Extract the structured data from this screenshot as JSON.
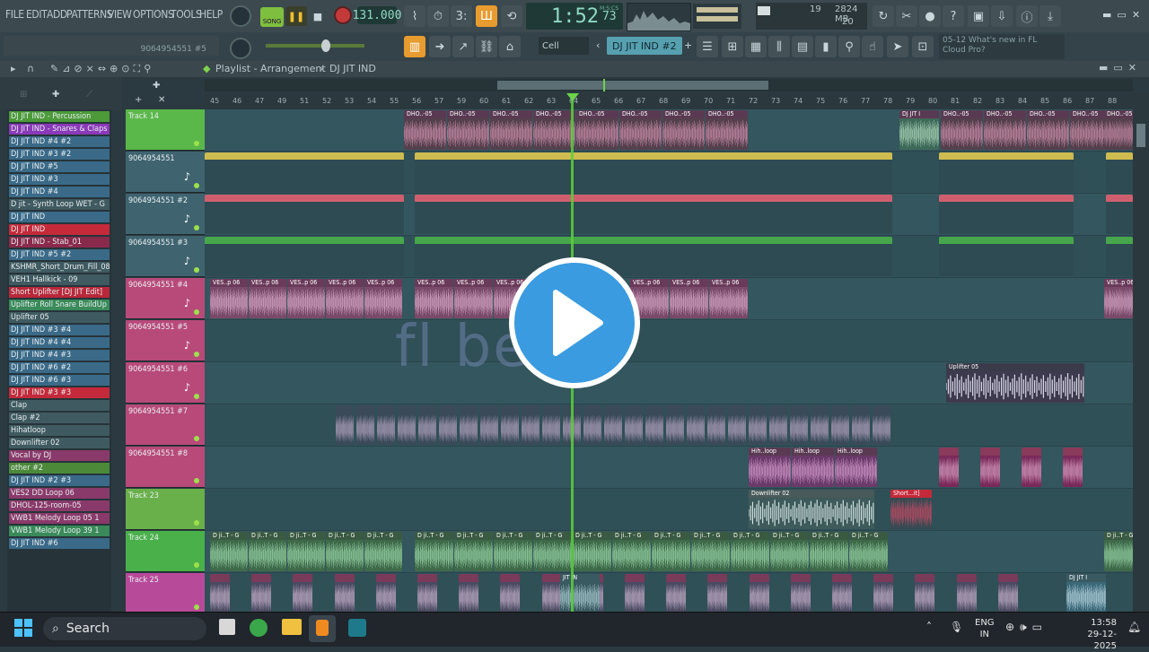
{
  "menu": [
    "FILE",
    "EDIT",
    "ADD",
    "PATTERNS",
    "VIEW",
    "OPTIONS",
    "TOOLS",
    "HELP"
  ],
  "transport": {
    "song_label": "SONG",
    "tempo": "131.000",
    "time": "1:52",
    "time_small": "73",
    "time_unit": "M:S:CS"
  },
  "cpu": {
    "voices": "19",
    "memory": "2824 MB",
    "polyphony": "20"
  },
  "hint": "9064954551 #5",
  "snap": "Cell",
  "pattern": "DJ JIT IND #2",
  "news": {
    "date": "05-12",
    "text": "What's new in FL Cloud Pro?"
  },
  "playlist": {
    "title": "Playlist - Arrangement",
    "breadcrumb": "DJ JIT IND"
  },
  "ruler": [
    "45",
    "46",
    "47",
    "49",
    "51",
    "52",
    "53",
    "54",
    "55",
    "56",
    "57",
    "59",
    "60",
    "61",
    "62",
    "63",
    "64",
    "65",
    "66",
    "67",
    "68",
    "69",
    "70",
    "71",
    "72",
    "73",
    "74",
    "75",
    "76",
    "77",
    "78",
    "79",
    "80",
    "81",
    "82",
    "83",
    "84",
    "85",
    "86",
    "87",
    "88"
  ],
  "picker": [
    {
      "label": "DJ JIT IND - Percussion",
      "color": "#4c9a3a"
    },
    {
      "label": "DJ JIT IND - Snares & Claps",
      "color": "#8a3ab8"
    },
    {
      "label": "DJ JIT IND #4 #2",
      "color": "#3a6a88"
    },
    {
      "label": "DJ JIT IND #3 #2",
      "color": "#3a6a88"
    },
    {
      "label": "DJ JIT IND #5",
      "color": "#3a6a88"
    },
    {
      "label": "DJ JIT IND #3",
      "color": "#3a6a88"
    },
    {
      "label": "DJ JIT IND #4",
      "color": "#3a6a88"
    },
    {
      "label": "D jit - Synth Loop WET - G",
      "color": "#3f5a60"
    },
    {
      "label": "DJ JIT IND",
      "color": "#3a6a88"
    },
    {
      "label": "DJ JIT IND",
      "color": "#c42a3a"
    },
    {
      "label": "DJ JIT IND - Stab_01",
      "color": "#8a2a4a"
    },
    {
      "label": "DJ JIT IND #5 #2",
      "color": "#3a6a88"
    },
    {
      "label": "KSHMR_Short_Drum_Fill_08",
      "color": "#3f5a60"
    },
    {
      "label": "VEH1 Hallkick - 09",
      "color": "#3f5a60"
    },
    {
      "label": "Short Uplifter [DJ JIT Edit]",
      "color": "#b8283a"
    },
    {
      "label": "Uplifter Roll Snare BuildUp",
      "color": "#3a8a5a"
    },
    {
      "label": "Uplifter 05",
      "color": "#3f5a60"
    },
    {
      "label": "DJ JIT IND #3 #4",
      "color": "#3a6a88"
    },
    {
      "label": "DJ JIT IND #4 #4",
      "color": "#3a6a88"
    },
    {
      "label": "DJ JIT IND #4 #3",
      "color": "#3a6a88"
    },
    {
      "label": "DJ JIT IND #6 #2",
      "color": "#3a6a88"
    },
    {
      "label": "DJ JIT IND #6 #3",
      "color": "#3a6a88"
    },
    {
      "label": "DJ JIT IND #3 #3",
      "color": "#c42a3a"
    },
    {
      "label": "Clap",
      "color": "#3f5a60"
    },
    {
      "label": "Clap #2",
      "color": "#3f5a60"
    },
    {
      "label": "Hihatloop",
      "color": "#3f5a60"
    },
    {
      "label": "Downlifter 02",
      "color": "#3f5a60"
    },
    {
      "label": "Vocal by DJ",
      "color": "#8a3a6a"
    },
    {
      "label": "other #2",
      "color": "#4c8a3a"
    },
    {
      "label": "DJ JIT IND #2 #3",
      "color": "#3a6a88"
    },
    {
      "label": "VES2 DD Loop 06",
      "color": "#8a3a6a"
    },
    {
      "label": "DHOL-125-room-05",
      "color": "#8a3a6a"
    },
    {
      "label": "VWB1 Melody Loop 05 1",
      "color": "#8a3a6a"
    },
    {
      "label": "VWB1 Melody Loop 39 1",
      "color": "#3a8a5a"
    },
    {
      "label": "DJ JIT IND #6",
      "color": "#3a6a88"
    }
  ],
  "tracks": [
    {
      "name": "Track 14",
      "color": "#5ab84a"
    },
    {
      "name": "9064954551",
      "color": "#3f6470"
    },
    {
      "name": "9064954551 #2",
      "color": "#3f6470"
    },
    {
      "name": "9064954551 #3",
      "color": "#3f6470"
    },
    {
      "name": "9064954551 #4",
      "color": "#b84a7a"
    },
    {
      "name": "9064954551 #5",
      "color": "#b84a7a"
    },
    {
      "name": "9064954551 #6",
      "color": "#b84a7a"
    },
    {
      "name": "9064954551 #7",
      "color": "#b84a7a"
    },
    {
      "name": "9064954551 #8",
      "color": "#b84a7a"
    },
    {
      "name": "Track 23",
      "color": "#6ab04a"
    },
    {
      "name": "Track 24",
      "color": "#4ab04a"
    },
    {
      "name": "Track 25",
      "color": "#b84a9a"
    }
  ],
  "clips": {
    "dhol": "DHO..-05",
    "ves": "VES..p 06",
    "uplifter": "Uplifter 05",
    "hih": "Hih..loop",
    "downlifter": "Downlifter 02",
    "short": "Short...it]",
    "djit": "D ji..T - G",
    "djit1": "DJ JIT I",
    "jitin": "JIT IN"
  },
  "watermark": "fl beer",
  "taskbar": {
    "search": "Search",
    "lang1": "ENG",
    "lang2": "IN",
    "time": "13:58",
    "date": "29-12-2025"
  }
}
